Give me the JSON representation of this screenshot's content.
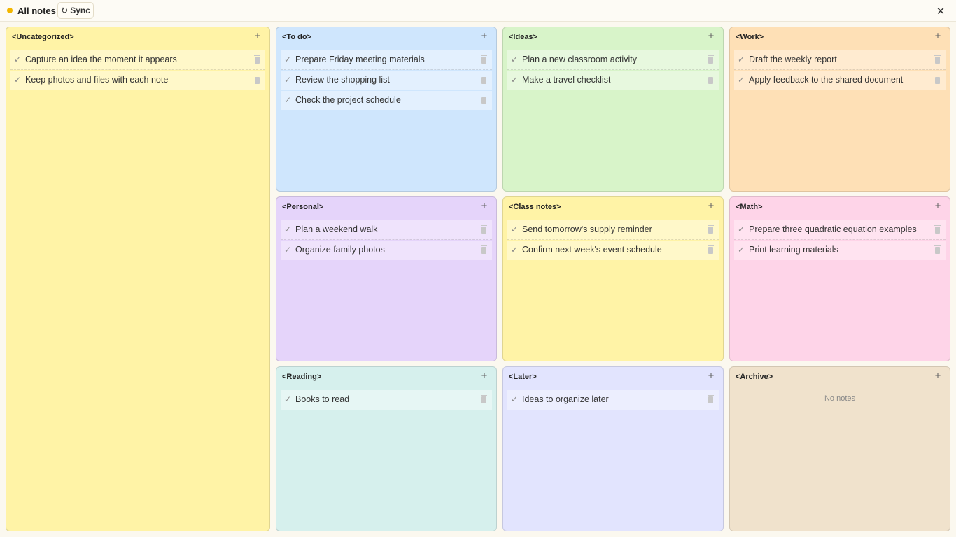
{
  "header": {
    "title": "All notes",
    "sync_label": "Sync",
    "sync_icon": "↻",
    "close_icon": "✕",
    "status_color": "#f2b600"
  },
  "panels": [
    {
      "title": "<Uncategorized>",
      "color": "#fff3a6",
      "note_bg": "#fff8c9",
      "notes": [
        "Capture an idea the moment it appears",
        "Keep photos and files with each note"
      ]
    },
    {
      "title": "<To do>",
      "color": "#cfe6fd",
      "note_bg": "#e3f0fe",
      "notes": [
        "Prepare Friday meeting materials",
        "Review the shopping list",
        "Check the project schedule"
      ]
    },
    {
      "title": "<Ideas>",
      "color": "#d8f4c9",
      "note_bg": "#e7f8de",
      "notes": [
        "Plan a new classroom activity",
        "Make a travel checklist"
      ]
    },
    {
      "title": "<Work>",
      "color": "#fee0b6",
      "note_bg": "#ffebd0",
      "notes": [
        "Draft the weekly report",
        "Apply feedback to the shared document"
      ]
    },
    {
      "title": "<Personal>",
      "color": "#e5d4fa",
      "note_bg": "#efe3fc",
      "notes": [
        "Plan a weekend walk",
        "Organize family photos"
      ]
    },
    {
      "title": "<Class notes>",
      "color": "#fff3a6",
      "note_bg": "#fff8c9",
      "notes": [
        "Send tomorrow's supply reminder",
        "Confirm next week's event schedule"
      ]
    },
    {
      "title": "<Math>",
      "color": "#fed4e8",
      "note_bg": "#ffe3f0",
      "notes": [
        "Prepare three quadratic equation examples",
        "Print learning materials"
      ]
    },
    {
      "title": "<Reading>",
      "color": "#d6f0ed",
      "note_bg": "#e6f6f4",
      "notes": [
        "Books to read"
      ]
    },
    {
      "title": "<Later>",
      "color": "#e2e4fe",
      "note_bg": "#eceefe",
      "notes": [
        "Ideas to organize later"
      ]
    },
    {
      "title": "<Archive>",
      "color": "#f0e2cc",
      "note_bg": "#f6ecdc",
      "notes": [],
      "empty_label": "No notes"
    }
  ],
  "icons": {
    "check": "✓",
    "add": "+",
    "delete": "trash-icon"
  }
}
